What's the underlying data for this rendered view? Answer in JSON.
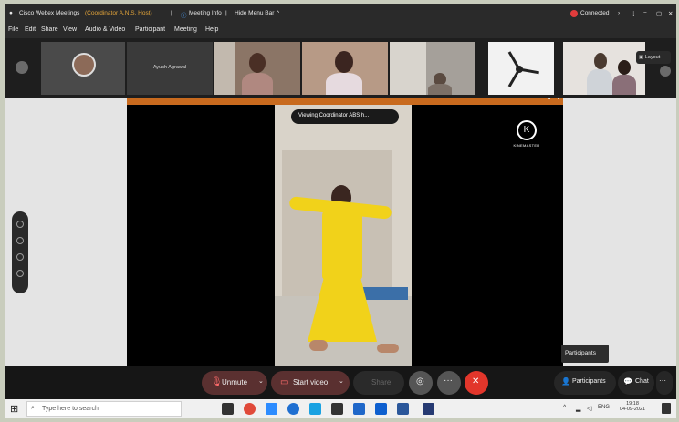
{
  "titlebar": {
    "app_title": "Cisco Webex Meetings",
    "host_note": "(Coordinator A.N.S. Host)",
    "meeting_info": "Meeting Info",
    "hide_menu_bar": "Hide Menu Bar",
    "connected": "Connected",
    "colors": {
      "connected_dot": "#e03c3c",
      "title_accent": "#e3a43a"
    }
  },
  "menubar": {
    "items": [
      "File",
      "Edit",
      "Share",
      "View",
      "Audio & Video",
      "Participant",
      "Meeting",
      "Help"
    ]
  },
  "filmstrip": {
    "tile_names": [
      "",
      "Ayush Agrawal",
      "",
      "",
      "",
      "",
      ""
    ],
    "layout_label": "Layout"
  },
  "stage": {
    "viewing_banner": "Viewing Coordinator ABS h...",
    "logo_text": "KINEMASTER",
    "colors": {
      "accent_bar": "#c86a1e",
      "dress": "#f1d21a"
    }
  },
  "controls": {
    "unmute": "Unmute",
    "start_video": "Start video",
    "share": "Share",
    "participants": "Participants",
    "chat": "Chat",
    "participants_tooltip": "Participants",
    "colors": {
      "unmute": "#5a3030",
      "end_call": "#e2362b"
    }
  },
  "taskbar": {
    "search_placeholder": "Type here to search",
    "language": "ENG",
    "time": "19:18",
    "date": "04-09-2021"
  }
}
